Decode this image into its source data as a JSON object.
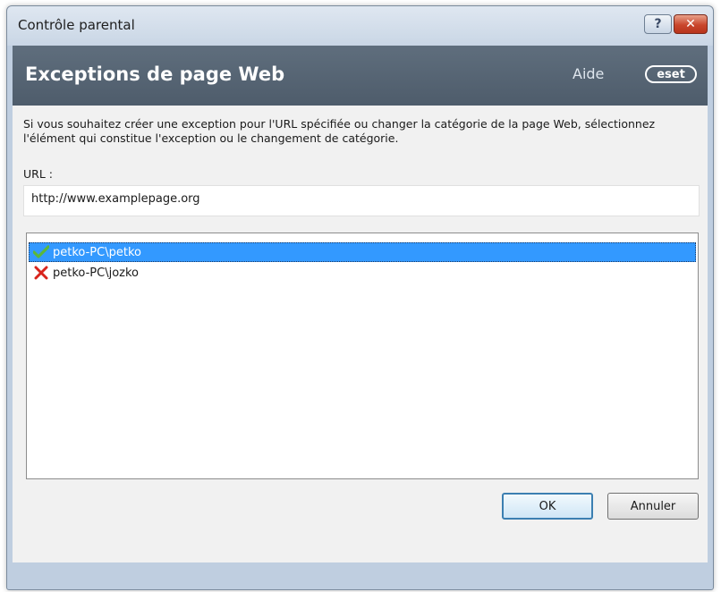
{
  "window": {
    "title": "Contrôle parental",
    "help_button_label": "?",
    "close_button_label": "✕"
  },
  "banner": {
    "title": "Exceptions de page Web",
    "help_link": "Aide",
    "logo_text": "eset"
  },
  "content": {
    "description": "Si vous souhaitez créer une exception pour l'URL spécifiée ou changer la catégorie de la page Web, sélectionnez l'élément qui constitue l'exception ou le changement de catégorie.",
    "url_label": "URL :",
    "url_value": "http://www.examplepage.org",
    "users": [
      {
        "name": "petko-PC\\petko",
        "status": "allowed",
        "icon": "check-icon"
      },
      {
        "name": "petko-PC\\jozko",
        "status": "blocked",
        "icon": "cross-icon"
      }
    ]
  },
  "buttons": {
    "ok_label": "OK",
    "cancel_label": "Annuler"
  },
  "colors": {
    "banner_bg": "#56636f",
    "selection": "#3399ff",
    "check": "#5bb83a",
    "cross": "#d8241c",
    "close_button": "#c9462c"
  }
}
